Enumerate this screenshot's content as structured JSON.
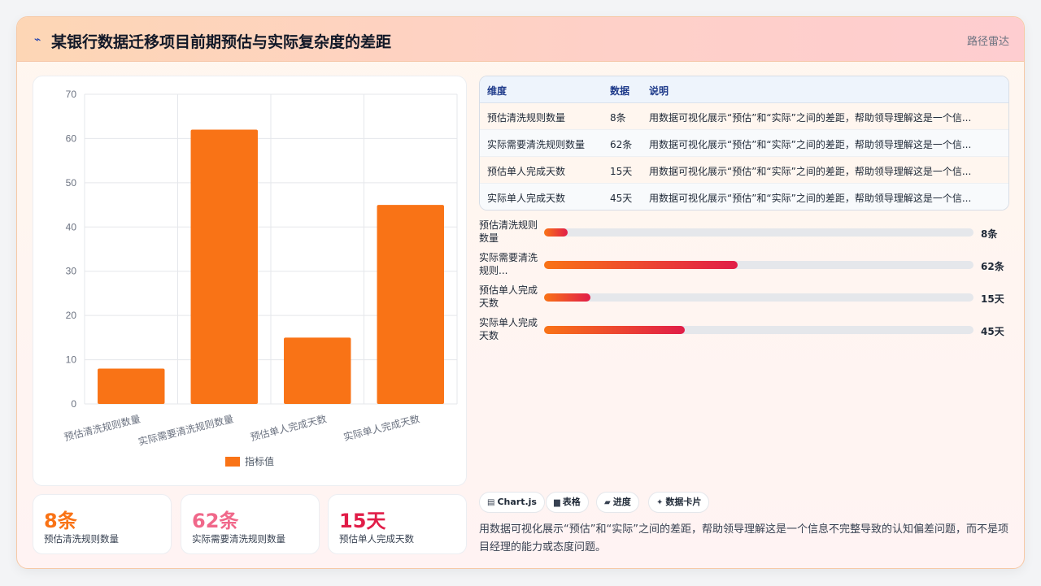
{
  "header": {
    "title": "某银行数据迁移项目前期预估与实际复杂度的差距",
    "tag": "路径雷达"
  },
  "colors": {
    "bar": "#f97316",
    "kpi": [
      "#f97316",
      "#f0688a",
      "#e11d48"
    ]
  },
  "chart_data": {
    "type": "bar",
    "categories": [
      "预估清洗规则数量",
      "实际需要清洗规则数量",
      "预估单人完成天数",
      "实际单人完成天数"
    ],
    "series": [
      {
        "name": "指标值",
        "values": [
          8,
          62,
          15,
          45
        ]
      }
    ],
    "ylim": [
      0,
      70
    ],
    "yticks": [
      0,
      10,
      20,
      30,
      40,
      50,
      60,
      70
    ],
    "grid": true,
    "legend": "bottom"
  },
  "kpis": [
    {
      "value": "8条",
      "label": "预估清洗规则数量"
    },
    {
      "value": "62条",
      "label": "实际需要清洗规则数量"
    },
    {
      "value": "15天",
      "label": "预估单人完成天数"
    }
  ],
  "table": {
    "headers": [
      "维度",
      "数据",
      "说明"
    ],
    "rows": [
      {
        "dim": "预估清洗规则数量",
        "data": "8条",
        "desc": "用数据可视化展示“预估”和“实际”之间的差距，帮助领导理解这是一个信..."
      },
      {
        "dim": "实际需要清洗规则数量",
        "data": "62条",
        "desc": "用数据可视化展示“预估”和“实际”之间的差距，帮助领导理解这是一个信..."
      },
      {
        "dim": "预估单人完成天数",
        "data": "15天",
        "desc": "用数据可视化展示“预估”和“实际”之间的差距，帮助领导理解这是一个信..."
      },
      {
        "dim": "实际单人完成天数",
        "data": "45天",
        "desc": "用数据可视化展示“预估”和“实际”之间的差距，帮助领导理解这是一个信..."
      }
    ]
  },
  "progress": [
    {
      "label": "预估清洗规则数量",
      "value_text": "8条",
      "fraction": 0.055
    },
    {
      "label": "实际需要清洗规则...",
      "value_text": "62条",
      "fraction": 0.45
    },
    {
      "label": "预估单人完成天数",
      "value_text": "15天",
      "fraction": 0.108
    },
    {
      "label": "实际单人完成天数",
      "value_text": "45天",
      "fraction": 0.327
    }
  ],
  "chips": [
    {
      "icon": "chart-icon",
      "glyph": "▤",
      "label": "Chart.js"
    },
    {
      "icon": "table-icon",
      "glyph": "▆",
      "label": "表格"
    },
    {
      "icon": "progress-icon",
      "glyph": "▰",
      "label": "进度"
    },
    {
      "icon": "card-icon",
      "glyph": "✦",
      "label": "数据卡片"
    }
  ],
  "summary": "用数据可视化展示“预估”和“实际”之间的差距，帮助领导理解这是一个信息不完整导致的认知偏差问题，而不是项目经理的能力或态度问题。"
}
